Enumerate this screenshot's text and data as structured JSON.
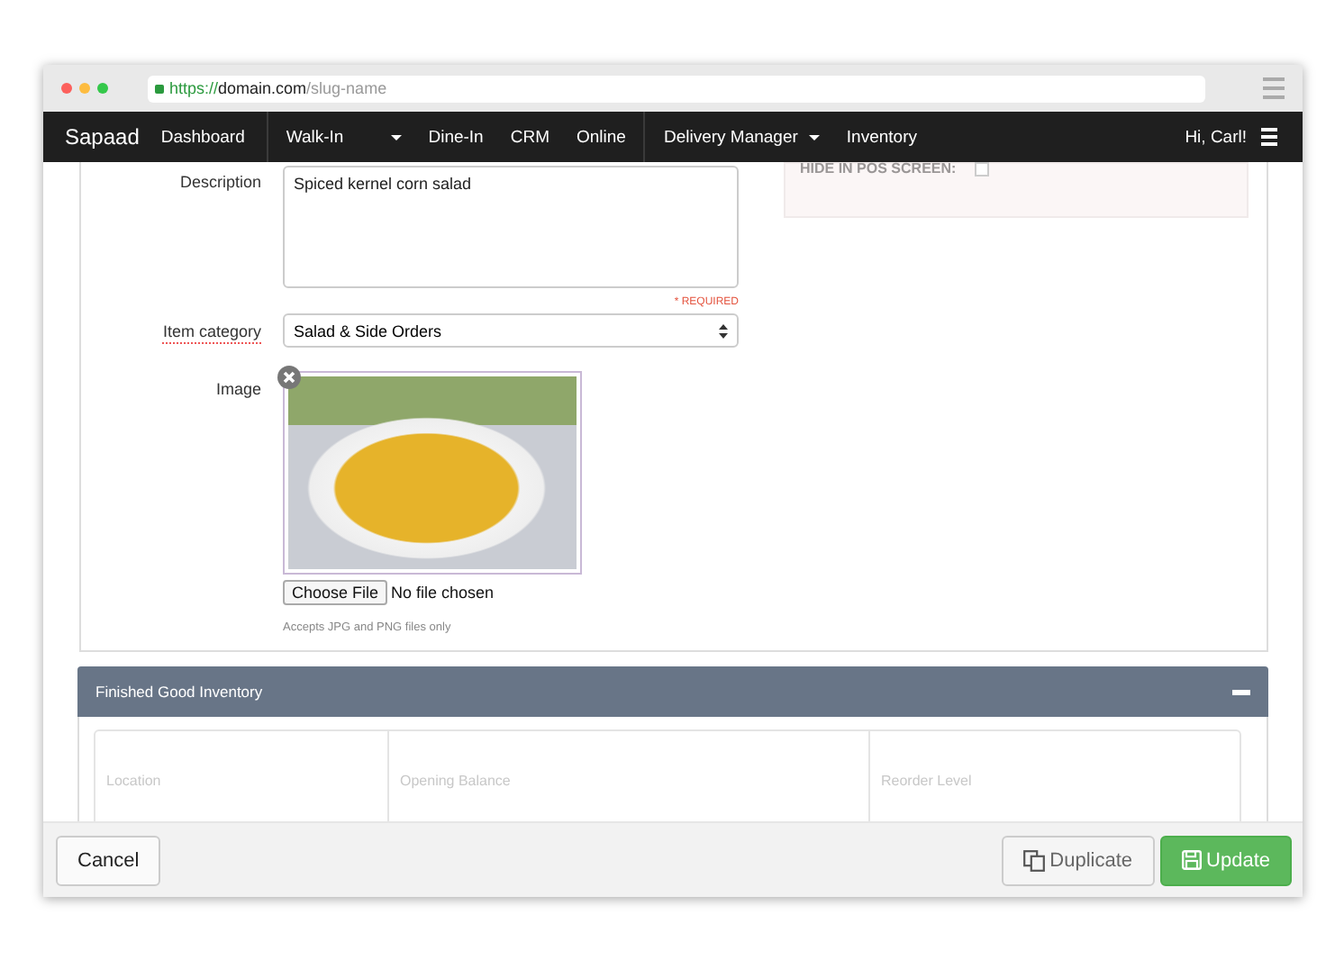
{
  "browser": {
    "url_scheme": "https://",
    "url_domain": "domain.com",
    "url_path": "/slug-name"
  },
  "nav": {
    "brand": "Sapaad",
    "items": [
      {
        "label": "Dashboard",
        "dropdown": false,
        "divider_after": true
      },
      {
        "label": "Walk-In",
        "dropdown": true,
        "divider_after": false
      },
      {
        "label": "Dine-In",
        "dropdown": false,
        "divider_after": false
      },
      {
        "label": "CRM",
        "dropdown": false,
        "divider_after": false
      },
      {
        "label": "Online",
        "dropdown": false,
        "divider_after": true
      },
      {
        "label": "Delivery Manager",
        "dropdown": true,
        "divider_after": false
      },
      {
        "label": "Inventory",
        "dropdown": false,
        "divider_after": false
      }
    ],
    "user": "Hi, Carl!"
  },
  "side_panel": {
    "label": "HIDE IN POS SCREEN:",
    "checked": false
  },
  "form": {
    "description": {
      "label": "Description",
      "value": "Spiced kernel corn salad"
    },
    "item_category": {
      "label": "Item category",
      "required": "* REQUIRED",
      "value": "Salad & Side Orders"
    },
    "image": {
      "label": "Image",
      "choose_button": "Choose File",
      "file_status": "No file chosen",
      "hint": "Accepts JPG and PNG files only"
    }
  },
  "inventory": {
    "title": "Finished Good Inventory",
    "expanded": true,
    "columns": [
      "Location",
      "Opening Balance",
      "Reorder Level"
    ]
  },
  "footer": {
    "cancel": "Cancel",
    "duplicate": "Duplicate",
    "update": "Update"
  }
}
